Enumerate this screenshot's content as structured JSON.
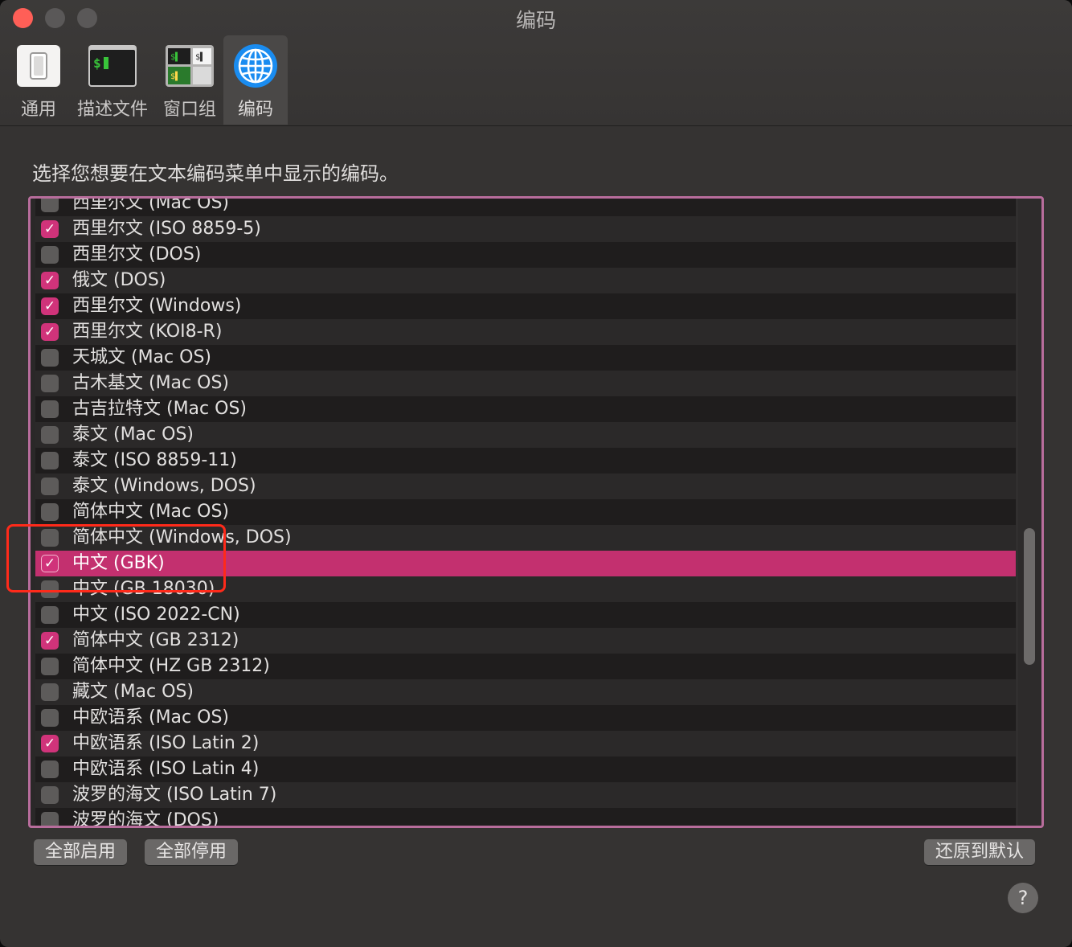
{
  "window": {
    "title": "编码"
  },
  "toolbar": {
    "items": [
      {
        "label": "通用",
        "icon": "switch-icon"
      },
      {
        "label": "描述文件",
        "icon": "terminal-icon"
      },
      {
        "label": "窗口组",
        "icon": "window-group-icon"
      },
      {
        "label": "编码",
        "icon": "globe-icon",
        "active": true
      }
    ]
  },
  "instruction": "选择您想要在文本编码菜单中显示的编码。",
  "encodings": [
    {
      "label": "西里尔文 (Mac OS)",
      "checked": false
    },
    {
      "label": "西里尔文 (ISO 8859-5)",
      "checked": true
    },
    {
      "label": "西里尔文 (DOS)",
      "checked": false
    },
    {
      "label": "俄文 (DOS)",
      "checked": true
    },
    {
      "label": "西里尔文 (Windows)",
      "checked": true
    },
    {
      "label": "西里尔文 (KOI8-R)",
      "checked": true
    },
    {
      "label": "天城文 (Mac OS)",
      "checked": false
    },
    {
      "label": "古木基文 (Mac OS)",
      "checked": false
    },
    {
      "label": "古吉拉特文 (Mac OS)",
      "checked": false
    },
    {
      "label": "泰文 (Mac OS)",
      "checked": false
    },
    {
      "label": "泰文 (ISO 8859-11)",
      "checked": false
    },
    {
      "label": "泰文 (Windows, DOS)",
      "checked": false
    },
    {
      "label": "简体中文 (Mac OS)",
      "checked": false
    },
    {
      "label": "简体中文 (Windows, DOS)",
      "checked": false
    },
    {
      "label": "中文 (GBK)",
      "checked": true,
      "selected": true
    },
    {
      "label": "中文 (GB 18030)",
      "checked": false
    },
    {
      "label": "中文 (ISO 2022-CN)",
      "checked": false
    },
    {
      "label": "简体中文 (GB 2312)",
      "checked": true
    },
    {
      "label": "简体中文 (HZ GB 2312)",
      "checked": false
    },
    {
      "label": "藏文 (Mac OS)",
      "checked": false
    },
    {
      "label": "中欧语系 (Mac OS)",
      "checked": false
    },
    {
      "label": "中欧语系 (ISO Latin 2)",
      "checked": true
    },
    {
      "label": "中欧语系 (ISO Latin 4)",
      "checked": false
    },
    {
      "label": "波罗的海文 (ISO Latin 7)",
      "checked": false
    },
    {
      "label": "波罗的海文 (DOS)",
      "checked": false
    }
  ],
  "buttons": {
    "enable_all": "全部启用",
    "disable_all": "全部停用",
    "restore_defaults": "还原到默认",
    "help": "?"
  },
  "colors": {
    "accent": "#c3306f",
    "frame": "#b86d9c",
    "annotation": "#ff2a1a"
  }
}
